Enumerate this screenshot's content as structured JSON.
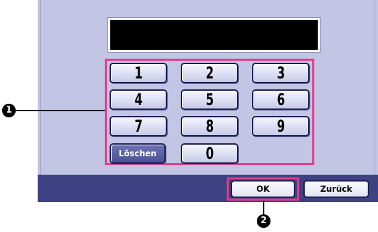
{
  "display": {
    "value": ""
  },
  "keypad": {
    "keys": [
      "1",
      "2",
      "3",
      "4",
      "5",
      "6",
      "7",
      "8",
      "9",
      "0"
    ],
    "clear_label": "Löschen"
  },
  "actions": {
    "ok_label": "OK",
    "back_label": "Zurück"
  },
  "callouts": {
    "one": "1",
    "two": "2"
  },
  "colors": {
    "panel_bg": "#c2c5e3",
    "bottom_bar": "#3e4282",
    "highlight": "#e8398a",
    "display_bg": "#000000"
  }
}
